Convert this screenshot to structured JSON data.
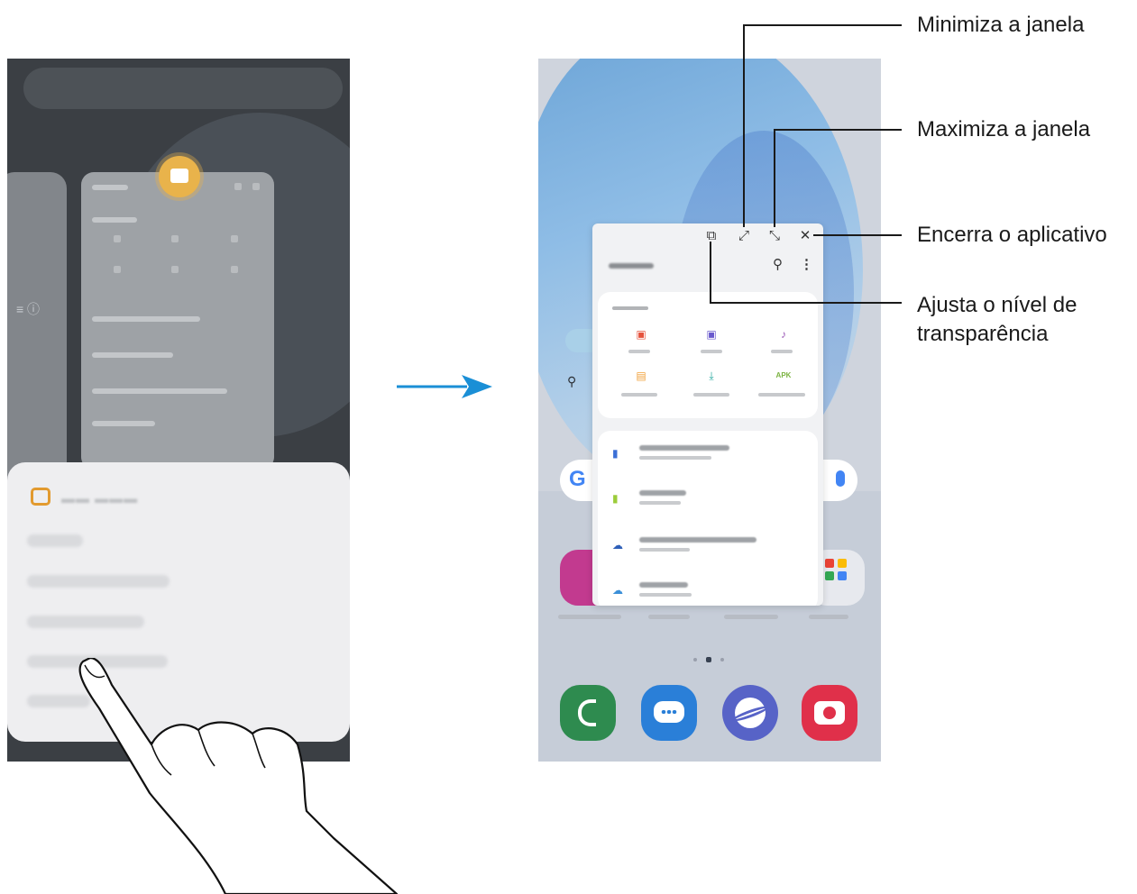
{
  "callouts": {
    "minimize": "Minimiza a janela",
    "maximize": "Maximiza a janela",
    "close": "Encerra o aplicativo",
    "transparency_line1": "Ajusta o nível de",
    "transparency_line2": "transparência"
  },
  "popup_window": {
    "controls": [
      "transparency-icon",
      "minimize-icon",
      "maximize-icon",
      "close-icon"
    ],
    "header_icons": [
      "search-icon",
      "more-options-icon"
    ]
  },
  "home_screen": {
    "search_logo": "G",
    "page_indicator": {
      "pages": 3,
      "current": 2
    },
    "dock": [
      "phone-icon",
      "messages-icon",
      "internet-icon",
      "camera-icon"
    ]
  },
  "colors": {
    "arrow": "#1a8fd6",
    "popup_bg": "#f1f2f4",
    "phone_app": "#2e8b4f",
    "messages_app": "#2a7fd8",
    "internet_app": "#5763c7",
    "camera_app": "#e0304a",
    "galaxy_store": "#c23a8f"
  }
}
